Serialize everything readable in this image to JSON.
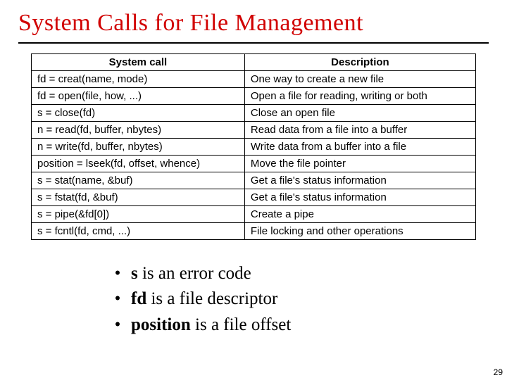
{
  "title": "System Calls for File Management",
  "table": {
    "headers": {
      "col1": "System call",
      "col2": "Description"
    },
    "rows": [
      {
        "call": "fd = creat(name, mode)",
        "desc": "One way to create a new file"
      },
      {
        "call": "fd = open(file, how, ...)",
        "desc": "Open a file for reading, writing or both"
      },
      {
        "call": "s = close(fd)",
        "desc": "Close an open file"
      },
      {
        "call": "n = read(fd, buffer, nbytes)",
        "desc": "Read data from a file into a buffer"
      },
      {
        "call": "n = write(fd, buffer, nbytes)",
        "desc": "Write data from a buffer into a file"
      },
      {
        "call": "position = lseek(fd, offset, whence)",
        "desc": "Move the file pointer"
      },
      {
        "call": "s = stat(name, &buf)",
        "desc": "Get a file's status information"
      },
      {
        "call": "s = fstat(fd, &buf)",
        "desc": "Get a file's status information"
      },
      {
        "call": "s = pipe(&fd[0])",
        "desc": "Create a pipe"
      },
      {
        "call": "s = fcntl(fd, cmd, ...)",
        "desc": "File locking and other operations"
      }
    ]
  },
  "notes": [
    {
      "term": "s",
      "rest": " is an error code"
    },
    {
      "term": "fd",
      "rest": " is a file descriptor"
    },
    {
      "term": "position",
      "rest": " is a file offset"
    }
  ],
  "bullet_char": "•",
  "page_number": "29"
}
